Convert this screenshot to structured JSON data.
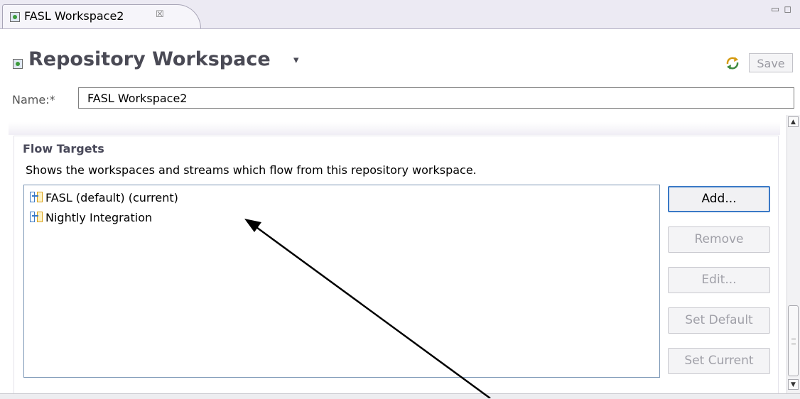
{
  "tab": {
    "icon": "repository-workspace-icon",
    "label": "FASL Workspace2",
    "close_glyph": "☒"
  },
  "window_controls": {
    "minimize": "▭",
    "maximize": "◻"
  },
  "header": {
    "icon": "repository-workspace-icon",
    "title": "Repository Workspace",
    "caret": "▾",
    "sync_icon": "sync-icon",
    "save_label": "Save"
  },
  "name_row": {
    "label": "Name:*",
    "value": "FASL Workspace2"
  },
  "flow_targets": {
    "heading": "Flow Targets",
    "description": "Shows the workspaces and streams which flow from this repository workspace.",
    "items": [
      {
        "label": "FASL (default) (current)",
        "icon": "flow-target-icon"
      },
      {
        "label": "Nightly Integration",
        "icon": "flow-target-icon"
      }
    ],
    "buttons": {
      "add": "Add...",
      "remove": "Remove",
      "edit": "Edit...",
      "set_default": "Set Default",
      "set_current": "Set Current"
    }
  },
  "colors": {
    "accent": "#3a79c6",
    "title_text": "#4a4a55",
    "disabled_text": "#a0a0a8",
    "tab_background": "#eceaf3"
  }
}
